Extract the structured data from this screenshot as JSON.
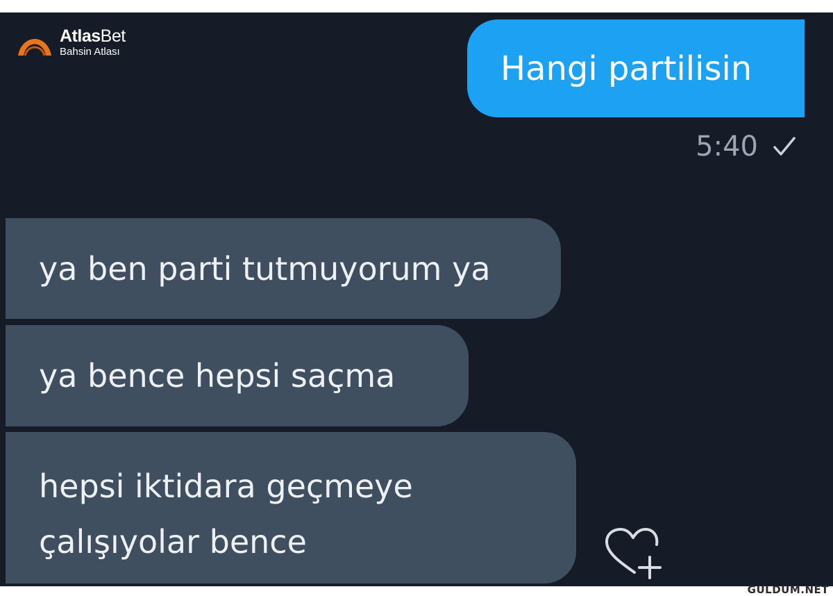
{
  "logo": {
    "name_bold": "Atlas",
    "name_regular": "Bet",
    "tagline": "Bahsin Atlası"
  },
  "messages": [
    {
      "direction": "outgoing",
      "text": "Hangi partilisin"
    },
    {
      "direction": "incoming",
      "text": "ya ben parti tutmuyorum ya"
    },
    {
      "direction": "incoming",
      "text": "ya bence hepsi saçma"
    },
    {
      "direction": "incoming",
      "lines": [
        "hepsi iktidara geçmeye",
        "çalışıyolar bence"
      ]
    }
  ],
  "meta": {
    "time": "5:40",
    "status_icon": "check-icon"
  },
  "icons": {
    "like": "heart-plus-icon"
  },
  "watermark": "GULDUM.NET",
  "colors": {
    "background": "#151c27",
    "outgoing_bubble": "#1da1f2",
    "incoming_bubble": "#3f4f5f",
    "logo_accent": "#e8741c"
  }
}
